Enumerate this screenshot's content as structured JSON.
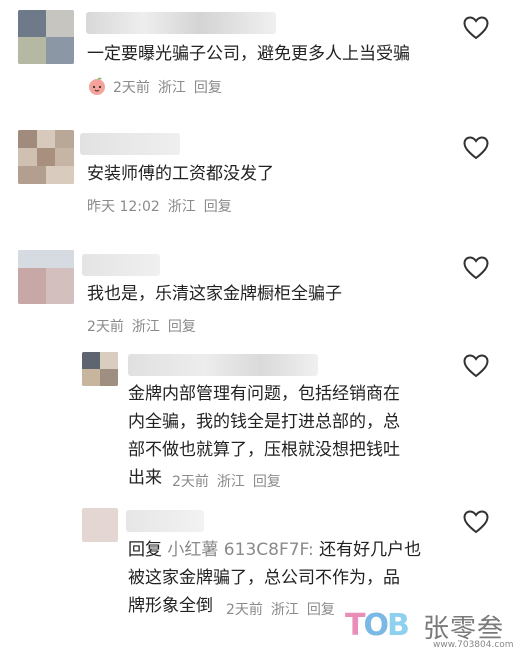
{
  "comments": [
    {
      "text": "一定要曝光骗子公司，避免更多人上当受骗",
      "time": "2天前",
      "location": "浙江",
      "reply_label": "回复",
      "has_sticker": true
    },
    {
      "text": "安装师傅的工资都没发了",
      "time": "昨天 12:02",
      "location": "浙江",
      "reply_label": "回复"
    },
    {
      "text": "我也是，乐清这家金牌橱柜全骗子",
      "time": "2天前",
      "location": "浙江",
      "reply_label": "回复"
    }
  ],
  "replies": [
    {
      "text_lines": [
        "金牌内部管理有问题，包括经销商在",
        "内全骗，我的钱全是打进总部的，总",
        "部不做也就算了，压根就没想把钱吐"
      ],
      "last_line": "出来",
      "time": "2天前",
      "location": "浙江",
      "reply_label": "回复"
    },
    {
      "prefix": "回复",
      "reply_to": "小红薯 613C8F7F:",
      "text_first": "还有好几户也",
      "text_lines": [
        "被这家金牌骗了，总公司不作为，品"
      ],
      "last_line": "牌形象全倒",
      "time": "2天前",
      "location": "浙江",
      "reply_label": "回复"
    }
  ],
  "watermark": {
    "logo": "TOB",
    "name": "张零叁",
    "url": "www.703804.com"
  },
  "colors": {
    "meta": "#8a8a8a",
    "text": "#222222",
    "heart": "#333333"
  }
}
